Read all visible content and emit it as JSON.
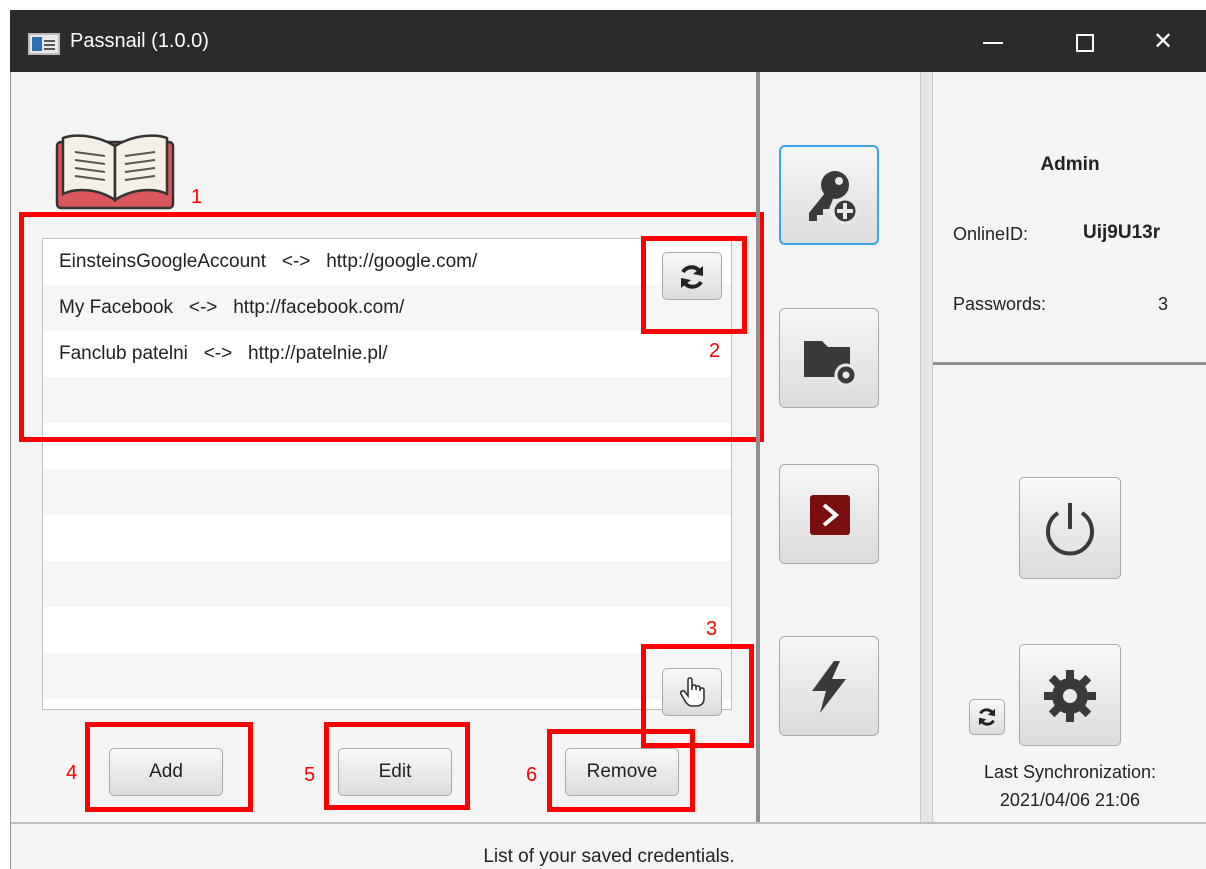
{
  "window": {
    "title": "Passnail (1.0.0)"
  },
  "credentials": {
    "rows": [
      "EinsteinsGoogleAccount   <->   http://google.com/",
      "My Facebook   <->   http://facebook.com/",
      "Fanclub patelni   <->   http://patelnie.pl/",
      "",
      "",
      "",
      "",
      "",
      "",
      "",
      ""
    ]
  },
  "buttons": {
    "add": "Add",
    "edit": "Edit",
    "remove": "Remove"
  },
  "icons": {
    "refresh": "refresh-icon",
    "hand": "hand-pointer-icon",
    "add_key": "key-add-icon",
    "folder_settings": "folder-settings-icon",
    "terminal": "chevron-right-icon",
    "lightning": "lightning-icon",
    "power": "power-icon",
    "settings": "gear-icon",
    "book": "book-icon"
  },
  "account": {
    "name": "Admin",
    "online_id_label": "OnlineID:",
    "online_id_value": "Uij9U13r",
    "passwords_label": "Passwords:",
    "passwords_value": "3",
    "last_sync_label": "Last Synchronization:",
    "last_sync_value": "2021/04/06 21:06"
  },
  "status_bar": {
    "text": "List of your saved credentials."
  },
  "annotations": [
    "1",
    "2",
    "3",
    "4",
    "5",
    "6"
  ],
  "colors": {
    "annotation": "#ff0000",
    "accent_border": "#3aa4e6",
    "terminal_red": "#7a0f0f",
    "titlebar": "#2b2b2b"
  }
}
